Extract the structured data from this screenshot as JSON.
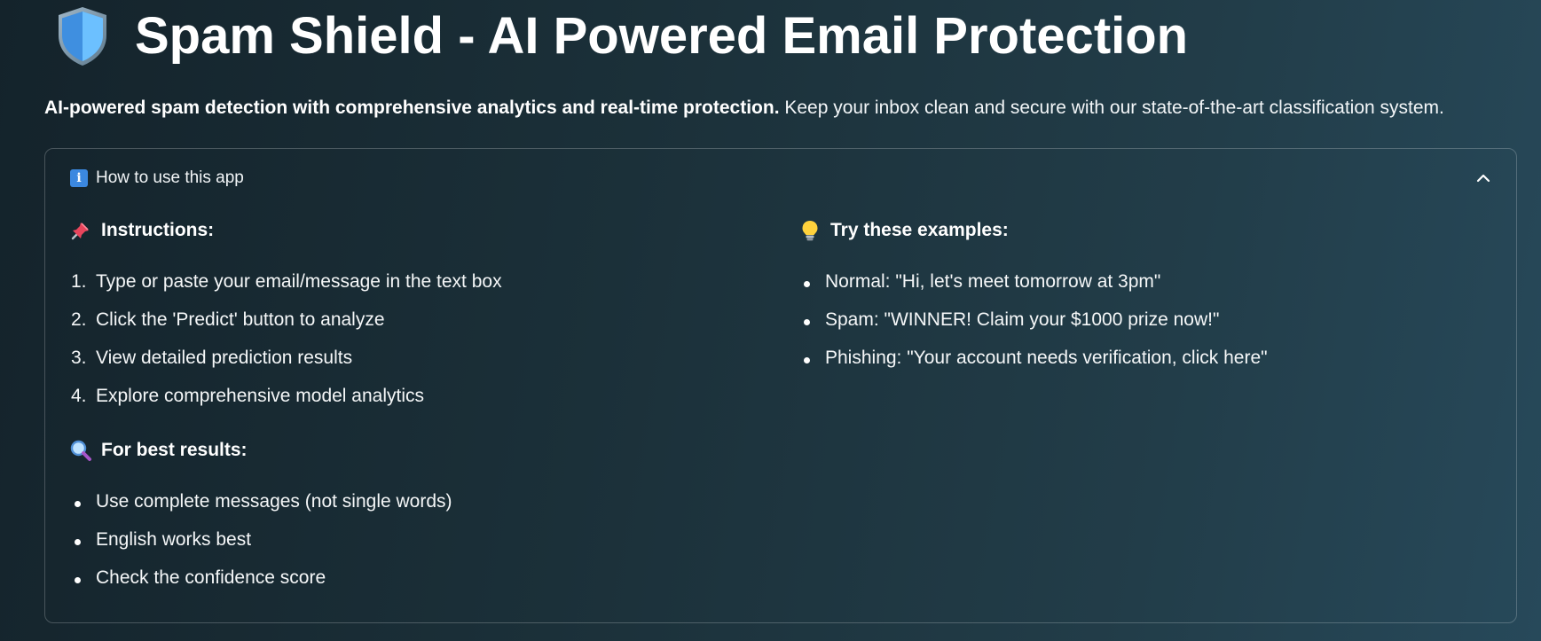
{
  "header": {
    "title": "Spam Shield - AI Powered Email Protection",
    "shield_icon": "shield-icon"
  },
  "subtitle": {
    "bold": "AI-powered spam detection with comprehensive analytics and real-time protection.",
    "rest": " Keep your inbox clean and secure with our state-of-the-art classification system."
  },
  "expander": {
    "label": "How to use this app",
    "info_icon": "info-icon",
    "chevron_icon": "chevron-up-icon",
    "instructions": {
      "heading": "Instructions:",
      "icon": "pushpin-icon",
      "items": [
        {
          "num": "1.",
          "text": "Type or paste your email/message in the text box"
        },
        {
          "num": "2.",
          "text": "Click the 'Predict' button to analyze"
        },
        {
          "num": "3.",
          "text": "View detailed prediction results"
        },
        {
          "num": "4.",
          "text": "Explore comprehensive model analytics"
        }
      ]
    },
    "best_results": {
      "heading": "For best results:",
      "icon": "magnifier-icon",
      "items": [
        "Use complete messages (not single words)",
        "English works best",
        "Check the confidence score"
      ]
    },
    "examples": {
      "heading": "Try these examples:",
      "icon": "lightbulb-icon",
      "items": [
        "Normal: \"Hi, let's meet tomorrow at 3pm\"",
        "Spam: \"WINNER! Claim your $1000 prize now!\"",
        "Phishing: \"Your account needs verification, click here\""
      ]
    }
  },
  "colors": {
    "background_start": "#14232b",
    "background_end": "#27495a",
    "shield_blue": "#4aa3f0",
    "info_blue": "#3b88e0"
  }
}
